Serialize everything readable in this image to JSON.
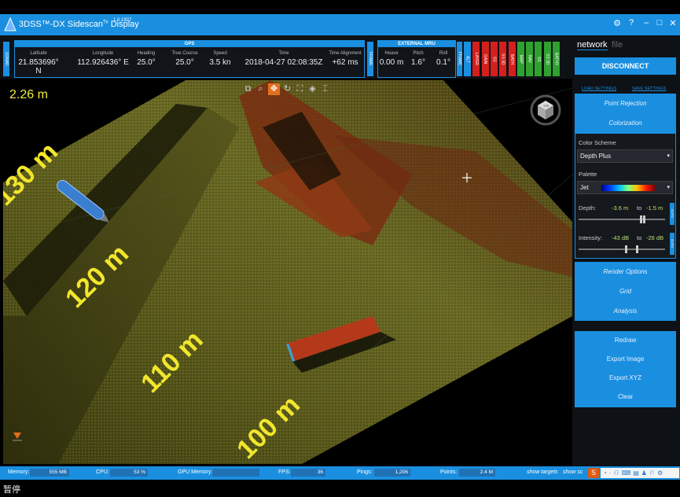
{
  "window": {
    "title": "3DSS™-DX Sidescan",
    "title_sup": "Tx",
    "title_tail": "Display",
    "version": "1.0.1927"
  },
  "left_tab": "SONAR",
  "gps": {
    "header": "GPS",
    "fields": [
      {
        "label": "Latitude",
        "value": "21.853696° N"
      },
      {
        "label": "Longitude",
        "value": "112.926436° E"
      },
      {
        "label": "Heading",
        "value": "25.0°"
      },
      {
        "label": "True Course",
        "value": "25.0°"
      },
      {
        "label": "Speed",
        "value": "3.5 kn"
      },
      {
        "label": "Time",
        "value": "2018-04-27 02:08:35Z"
      },
      {
        "label": "Time Alignment",
        "value": "+62 ms"
      }
    ],
    "right_tab": "FRAME"
  },
  "mru": {
    "header": "EXTERNAL MRU",
    "fields": [
      {
        "label": "Heave",
        "value": "0.00 m"
      },
      {
        "label": "Pitch",
        "value": "1.6°"
      },
      {
        "label": "Roll",
        "value": "0.1°"
      }
    ],
    "right_tab": "FRAME"
  },
  "status_tabs": [
    {
      "label": "ALT",
      "color": "blue"
    },
    {
      "label": "LAYER",
      "color": "red"
    },
    {
      "label": "GAIN",
      "color": "red"
    },
    {
      "label": "SS",
      "color": "red"
    },
    {
      "label": "SS 3D",
      "color": "red"
    },
    {
      "label": "BATH",
      "color": "red"
    },
    {
      "label": "MAP",
      "color": "green"
    },
    {
      "label": "NAV",
      "color": "green"
    },
    {
      "label": "SS",
      "color": "green"
    },
    {
      "label": "SS 3D",
      "color": "green"
    },
    {
      "label": "BATHY",
      "color": "green"
    }
  ],
  "viewport": {
    "depth_readout": "2.26 m",
    "range_labels": [
      "130 m",
      "120 m",
      "110 m",
      "100 m"
    ],
    "toolbar_icons": [
      "layers-icon",
      "zoom-icon",
      "pan-icon",
      "rotate-icon",
      "fit-icon",
      "target-icon",
      "frame-icon"
    ],
    "cube_label": "TOP"
  },
  "right_panel": {
    "tabs": [
      "network",
      "file"
    ],
    "disconnect_label": "DISCONNECT",
    "load_settings": "LOAD SETTINGS",
    "save_settings": "SAVE SETTINGS",
    "sections_top": [
      "Point Rejection",
      "Colorization"
    ],
    "color_scheme_label": "Color Scheme",
    "color_scheme_value": "Depth Plus",
    "palette_label": "Palette",
    "palette_value": "Jet",
    "depth": {
      "label": "Depth:",
      "from": "-3.6 m",
      "to_word": "to",
      "to": "-1.5 m",
      "knob1": 0.72,
      "knob2": 0.76
    },
    "intensity": {
      "label": "Intensity:",
      "from": "-43 dB",
      "to_word": "to",
      "to": "-26 dB",
      "knob1": 0.55,
      "knob2": 0.68
    },
    "auto_label": "AUTO",
    "sections_mid": [
      "Render Options",
      "Grid",
      "Analysis"
    ],
    "actions": [
      "Redraw",
      "Export Image",
      "Export XYZ",
      "Clear"
    ]
  },
  "status_bar": {
    "memory_label": "Memory:",
    "memory_value": "555 MB",
    "cpu_label": "CPU:",
    "cpu_value": "53 %",
    "gpu_label": "GPU Memory:",
    "gpu_value": "",
    "fps_label": "FPS:",
    "fps_value": "36",
    "pings_label": "Pings:",
    "pings_value": "1,206",
    "points_label": "Points:",
    "points_value": "2.4 M",
    "show_targets": "show targets",
    "show_sc": "show sc"
  },
  "pause_label": "暂停",
  "colors": {
    "accent": "#1a8fe0",
    "red": "#d4201c",
    "green": "#2fa12f",
    "range_text": "#f2e62c"
  }
}
